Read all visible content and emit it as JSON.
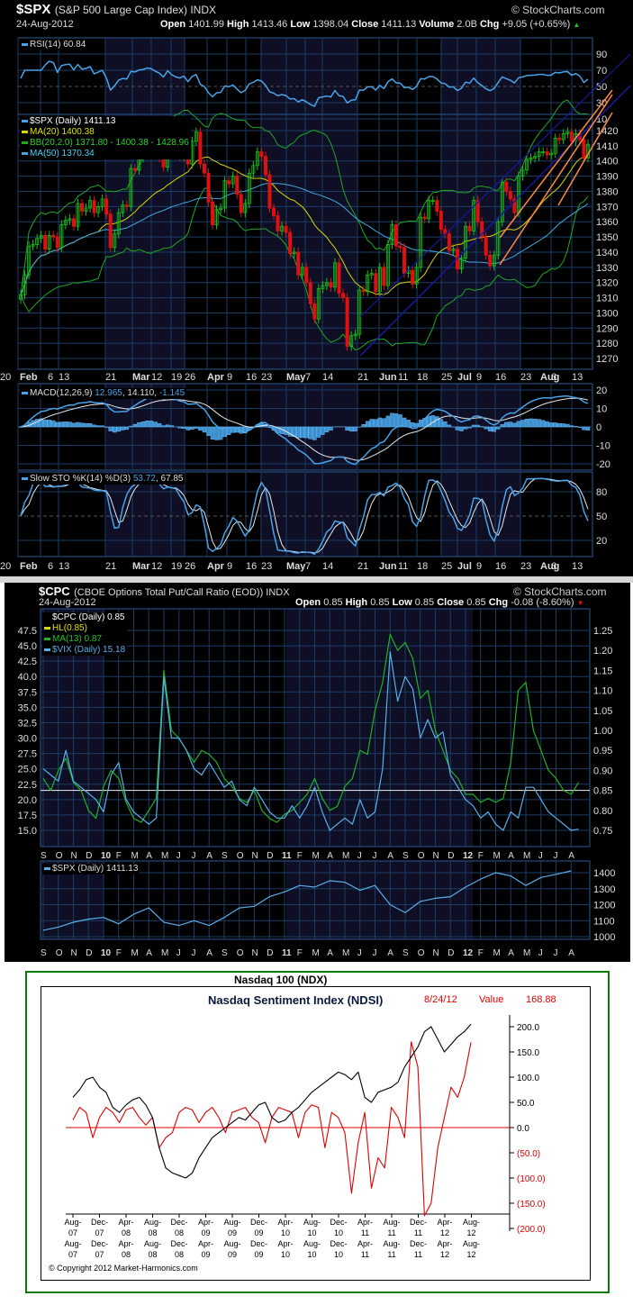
{
  "spx_panel": {
    "symbol": "$SPX",
    "name": "(S&P 500 Large Cap Index) INDX",
    "date": "24-Aug-2012",
    "watermark": "© StockCharts.com",
    "open_label": "Open",
    "open": "1401.99",
    "high_label": "High",
    "high": "1413.46",
    "low_label": "Low",
    "low": "1398.04",
    "close_label": "Close",
    "close": "1411.13",
    "volume_label": "Volume",
    "volume": "2.0B",
    "chg_label": "Chg",
    "chg": "+9.05 (+0.65%)",
    "rsi_legend": "RSI(14) 60.84",
    "price_legend": "$SPX (Daily) 1411.13",
    "ma20_legend": "MA(20) 1400.38",
    "bb_legend": "BB(20,2.0) 1371.80 - 1400.38 - 1428.96",
    "ma50_legend": "MA(50) 1370.34",
    "macd_legend_name": "MACD(12,26,9)",
    "macd_legend_v1": "12.965",
    "macd_legend_v2": ", 14.110,",
    "macd_legend_v3": "-1.145",
    "sto_legend_name": "Slow STO %K(14) %D(3)",
    "sto_legend_v1": "53.72",
    "sto_legend_v2": ", 67.85"
  },
  "cpc_panel": {
    "symbol": "$CPC",
    "name": "(CBOE Options Total Put/Call Ratio (EOD)) INDX",
    "date": "24-Aug-2012",
    "watermark": "© StockCharts.com",
    "open_label": "Open",
    "open": "0.85",
    "high_label": "High",
    "high": "0.85",
    "low_label": "Low",
    "low": "0.85",
    "close_label": "Close",
    "close": "0.85",
    "chg_label": "Chg",
    "chg": "-0.08 (-8.60%)",
    "cpc_legend": "$CPC (Daily) 0.85",
    "hl_legend": "HL(0.85)",
    "ma_legend": "MA(13) 0.87",
    "vix_legend": "$VIX (Daily) 15.18",
    "spx_legend": "$SPX (Daily) 1411.13"
  },
  "ndsi_panel": {
    "outer_title": "Nasdaq 100 (NDX)",
    "title": "Nasdaq Sentiment Index (NDSI)",
    "date": "8/24/12",
    "value_label": "Value",
    "value": "168.88",
    "copyright": "© Copyright 2012 Market-Harmonics.com"
  },
  "colors": {
    "up": "#19c119",
    "down": "#e01010",
    "ma20": "#d8d800",
    "bb": "#1fa81f",
    "ma50": "#3fa9e0",
    "rsi": "#4aa3e8",
    "signal": "#e8e8e8",
    "grid": "#1c3c66",
    "band": "#0e0e24",
    "vix": "#5aaee8",
    "cpc_ma": "#22b022",
    "trend_blue": "#1818a0",
    "trend_orange": "#ff8a40",
    "ndx": "#000000",
    "ndsi": "#e00000"
  },
  "chart_data": [
    {
      "type": "candlestick",
      "title": "$SPX Daily Feb–Aug 2012",
      "x_tick_labels": [
        "Feb",
        "6",
        "13",
        "21",
        "Mar",
        "12",
        "19",
        "26",
        "Apr",
        "9",
        "16",
        "23",
        "May",
        "7",
        "14",
        "21",
        "Jun",
        "11",
        "18",
        "25",
        "Jul",
        "9",
        "16",
        "23",
        "Aug",
        "6",
        "13",
        "20"
      ],
      "ylim": [
        1265,
        1430
      ],
      "y_ticks": [
        1270,
        1280,
        1290,
        1300,
        1310,
        1320,
        1330,
        1340,
        1350,
        1360,
        1370,
        1380,
        1390,
        1400,
        1410,
        1420
      ],
      "rsi_ticks": [
        90,
        70,
        50,
        30,
        10
      ],
      "macd_ticks": [
        20,
        10,
        0,
        -10,
        -20
      ],
      "sto_ticks": [
        80,
        50,
        20
      ],
      "closes": [
        1312,
        1325,
        1344,
        1345,
        1349,
        1351,
        1342,
        1351,
        1350,
        1343,
        1358,
        1361,
        1362,
        1357,
        1372,
        1367,
        1369,
        1374,
        1366,
        1370,
        1375,
        1365,
        1343,
        1352,
        1366,
        1371,
        1370,
        1395,
        1394,
        1402,
        1404,
        1410,
        1409,
        1405,
        1402,
        1396,
        1416,
        1409,
        1405,
        1403,
        1408,
        1398,
        1413,
        1419,
        1398,
        1392,
        1373,
        1358,
        1368,
        1369,
        1387,
        1385,
        1390,
        1378,
        1366,
        1372,
        1392,
        1397,
        1406,
        1403,
        1391,
        1369,
        1364,
        1354,
        1357,
        1353,
        1339,
        1340,
        1325,
        1330,
        1320,
        1306,
        1296,
        1316,
        1318,
        1320,
        1317,
        1333,
        1313,
        1310,
        1278,
        1285,
        1286,
        1315,
        1314,
        1325,
        1326,
        1314,
        1330,
        1318,
        1345,
        1358,
        1344,
        1343,
        1326,
        1328,
        1319,
        1330,
        1363,
        1362,
        1374,
        1374,
        1367,
        1355,
        1352,
        1341,
        1342,
        1329,
        1336,
        1357,
        1354,
        1374,
        1360,
        1350,
        1338,
        1331,
        1338,
        1360,
        1386,
        1380,
        1375,
        1366,
        1390,
        1394,
        1401,
        1402,
        1403,
        1406,
        1406,
        1404,
        1405,
        1415,
        1414,
        1418,
        1419,
        1413,
        1418,
        1414,
        1402,
        1411
      ]
    },
    {
      "type": "line",
      "title": "$CPC MA(13) and $VIX, Sep 2009 – Aug 2012",
      "x_tick_labels": [
        "S",
        "O",
        "N",
        "D",
        "10",
        "F",
        "M",
        "A",
        "M",
        "J",
        "J",
        "A",
        "S",
        "O",
        "N",
        "D",
        "11",
        "F",
        "M",
        "A",
        "M",
        "J",
        "J",
        "A",
        "S",
        "O",
        "N",
        "D",
        "12",
        "F",
        "M",
        "A",
        "M",
        "J",
        "J",
        "A"
      ],
      "left_ticks": [
        "47.5",
        "45.0",
        "42.5",
        "40.0",
        "37.5",
        "35.0",
        "32.5",
        "30.0",
        "27.5",
        "25.0",
        "22.5",
        "20.0",
        "17.5",
        "15.0"
      ],
      "right_ticks": [
        "1.25",
        "1.20",
        "1.15",
        "1.10",
        "1.05",
        "1.00",
        "0.95",
        "0.90",
        "0.85",
        "0.80",
        "0.75"
      ],
      "hl": 0.85,
      "vix": [
        25,
        24,
        23,
        28,
        23,
        22,
        21,
        20,
        18,
        24,
        26,
        20,
        18,
        17,
        16,
        17,
        40,
        30,
        30,
        28,
        25,
        24,
        26,
        24,
        22,
        23,
        20,
        19,
        22,
        20,
        18,
        17,
        17,
        19,
        17,
        19,
        22,
        18,
        15,
        16,
        17,
        16,
        20,
        17,
        18,
        25,
        44,
        36,
        40,
        38,
        30,
        33,
        30,
        31,
        24,
        22,
        20,
        19,
        17,
        18,
        16,
        15,
        18,
        17,
        22,
        22,
        20,
        18,
        17,
        16,
        15,
        15.18
      ],
      "cpc_ma13": [
        0.88,
        0.85,
        0.9,
        0.93,
        0.87,
        0.85,
        0.8,
        0.78,
        0.86,
        0.9,
        0.88,
        0.82,
        0.78,
        0.77,
        0.8,
        0.83,
        1.15,
        1.0,
        0.98,
        0.95,
        0.92,
        0.95,
        0.94,
        0.92,
        0.88,
        0.86,
        0.83,
        0.82,
        0.85,
        0.8,
        0.78,
        0.77,
        0.79,
        0.8,
        0.82,
        0.84,
        0.88,
        0.83,
        0.8,
        0.81,
        0.86,
        0.88,
        0.95,
        0.94,
        1.05,
        1.12,
        1.24,
        1.2,
        1.22,
        1.18,
        1.08,
        1.1,
        1.0,
        0.95,
        0.9,
        0.88,
        0.84,
        0.84,
        0.82,
        0.83,
        0.82,
        0.83,
        0.92,
        1.1,
        1.12,
        1.0,
        0.95,
        0.9,
        0.88,
        0.85,
        0.84,
        0.87
      ],
      "spx_ticks": [
        1400,
        1300,
        1200,
        1100,
        1000
      ],
      "spx_monthly": [
        1040,
        1060,
        1090,
        1110,
        1120,
        1080,
        1140,
        1180,
        1090,
        1070,
        1100,
        1070,
        1120,
        1180,
        1190,
        1250,
        1280,
        1320,
        1310,
        1350,
        1340,
        1290,
        1320,
        1200,
        1150,
        1220,
        1240,
        1250,
        1310,
        1360,
        1400,
        1380,
        1320,
        1370,
        1390,
        1411
      ]
    },
    {
      "type": "line",
      "title": "Nasdaq Sentiment Index (NDSI)",
      "ylim": [
        -200,
        200
      ],
      "y_ticks": [
        "200.0",
        "150.0",
        "100.0",
        "50.0",
        "0.0",
        "(50.0)",
        "(100.0)",
        "(150.0)",
        "(200.0)"
      ],
      "x_tick_labels": [
        "Aug-07",
        "Dec-07",
        "Apr-08",
        "Aug-08",
        "Dec-08",
        "Apr-09",
        "Aug-09",
        "Dec-09",
        "Apr-10",
        "Aug-10",
        "Dec-10",
        "Apr-11",
        "Aug-11",
        "Dec-11",
        "Apr-12",
        "Aug-12"
      ],
      "series": [
        {
          "name": "Nasdaq 100 (NDX)",
          "values": [
            60,
            75,
            95,
            100,
            80,
            70,
            40,
            30,
            45,
            55,
            60,
            45,
            20,
            -40,
            -80,
            -90,
            -95,
            -100,
            -90,
            -60,
            -40,
            -20,
            -10,
            0,
            10,
            20,
            15,
            30,
            45,
            50,
            20,
            10,
            15,
            30,
            40,
            55,
            70,
            80,
            90,
            100,
            110,
            105,
            95,
            110,
            60,
            50,
            70,
            75,
            80,
            90,
            120,
            140,
            160,
            190,
            200,
            175,
            150,
            165,
            180,
            190,
            205
          ]
        },
        {
          "name": "NDSI",
          "values": [
            15,
            40,
            30,
            -20,
            20,
            40,
            30,
            10,
            35,
            40,
            20,
            5,
            20,
            -40,
            -20,
            -10,
            30,
            40,
            35,
            10,
            30,
            40,
            20,
            -10,
            30,
            35,
            40,
            20,
            10,
            -30,
            20,
            40,
            35,
            30,
            -20,
            30,
            45,
            40,
            -40,
            30,
            20,
            -10,
            -130,
            -30,
            30,
            -120,
            -60,
            -80,
            40,
            20,
            -20,
            170,
            120,
            -175,
            -150,
            -40,
            20,
            80,
            60,
            100,
            169
          ]
        }
      ]
    }
  ]
}
